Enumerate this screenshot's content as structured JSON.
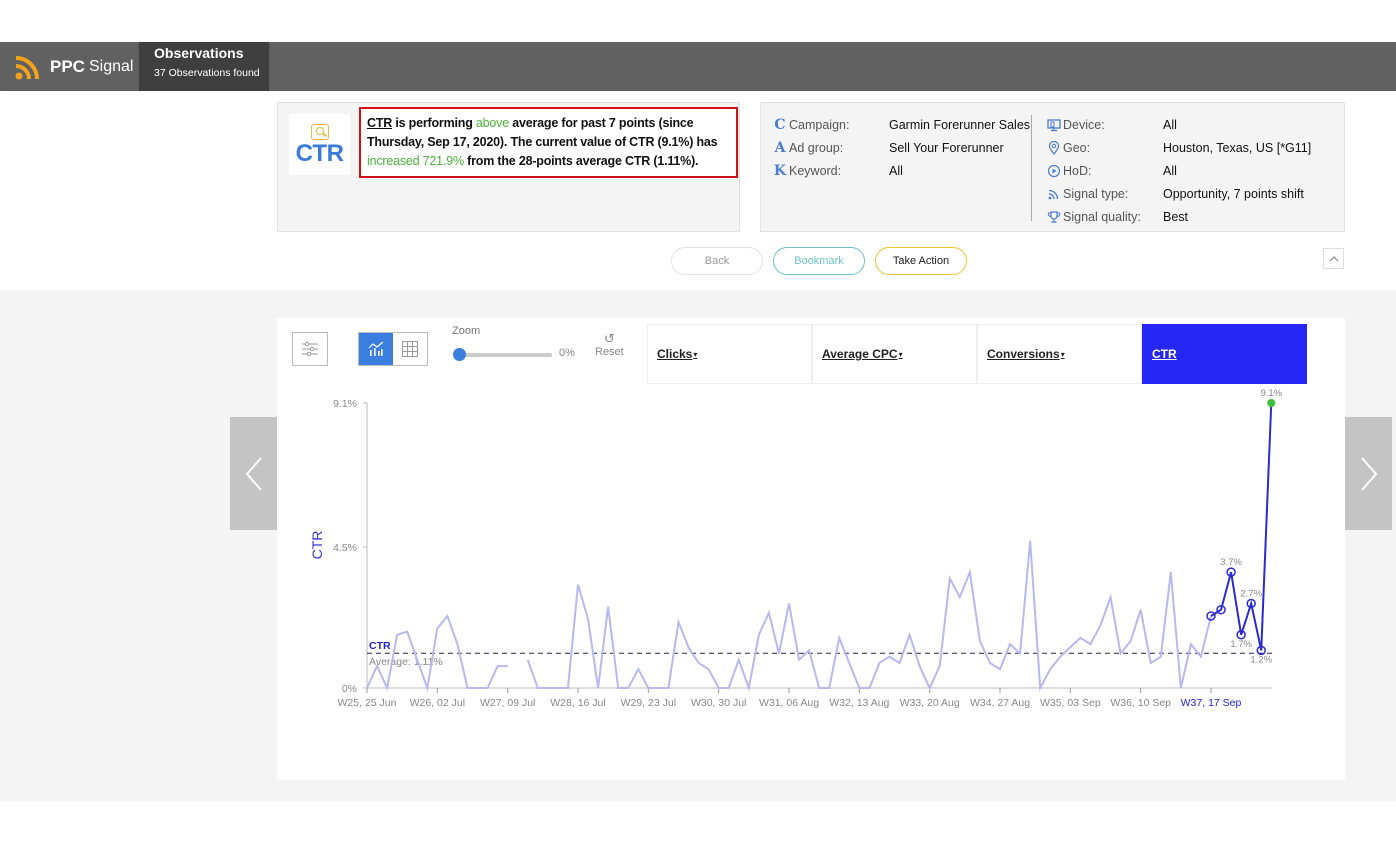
{
  "header": {
    "brand_bold": "PPC",
    "brand_light": "Signal",
    "tab_title": "Observations",
    "tab_subtitle": "37 Observations found"
  },
  "insight": {
    "icon_label": "CTR",
    "metric": "CTR",
    "part1": " is performing ",
    "direction": "above",
    "part2": " average for past 7 points (since Thursday, Sep 17, 2020). The current value of CTR (9.1%) has ",
    "change": "increased 721.9%",
    "part3": " from the 28-points average CTR (1.11%)."
  },
  "meta": {
    "left": [
      {
        "icon": "campaign-icon",
        "glyph": "C",
        "label": "Campaign:",
        "value": "Garmin Forerunner Sales"
      },
      {
        "icon": "ad-group-icon",
        "glyph": "A",
        "label": "Ad group:",
        "value": "Sell Your Forerunner"
      },
      {
        "icon": "keyword-icon",
        "glyph": "K",
        "label": "Keyword:",
        "value": "All"
      }
    ],
    "right": [
      {
        "icon": "device-icon",
        "label": "Device:",
        "value": "All"
      },
      {
        "icon": "geo-pin-icon",
        "label": "Geo:",
        "value": "Houston, Texas, US [*G11]"
      },
      {
        "icon": "hod-clock-icon",
        "label": "HoD:",
        "value": "All"
      },
      {
        "icon": "signal-type-icon",
        "label": "Signal type:",
        "value": "Opportunity, 7 points shift"
      },
      {
        "icon": "trophy-icon",
        "label": "Signal quality:",
        "value": "Best"
      }
    ]
  },
  "actions": {
    "back": "Back",
    "bookmark": "Bookmark",
    "take_action": "Take Action"
  },
  "toolbar": {
    "zoom_label": "Zoom",
    "zoom_value": "0%",
    "zoom_fraction": 0,
    "reset_label": "Reset"
  },
  "metric_tabs": [
    {
      "label": "Clicks",
      "arrow": "▾",
      "active": false
    },
    {
      "label": "Average CPC",
      "arrow": "▾",
      "active": false
    },
    {
      "label": "Conversions",
      "arrow": "▾",
      "active": false
    },
    {
      "label": "CTR",
      "arrow": "",
      "active": true
    }
  ],
  "colors": {
    "accent_blue": "#2626f5",
    "line_light": "#b8b8f0",
    "highlight_line": "#2a2ad4",
    "current_point": "#3cc03c",
    "green_text": "#4bb33a",
    "alert_red": "#d0121b"
  },
  "chart_data": {
    "type": "line",
    "title": "",
    "ylabel": "CTR",
    "xlabel": "",
    "ylim": [
      0,
      9.1
    ],
    "yticks": [
      "0%",
      "4.5%",
      "9.1%"
    ],
    "ytick_values": [
      0,
      4.5,
      9.1
    ],
    "xticks": [
      "W25, 25 Jun",
      "W26, 02 Jul",
      "W27, 09 Jul",
      "W28, 16 Jul",
      "W29, 23 Jul",
      "W30, 30 Jul",
      "W31, 06 Aug",
      "W32, 13 Aug",
      "W33, 20 Aug",
      "W34, 27 Aug",
      "W35, 03 Sep",
      "W36, 10 Sep",
      "W37, 17 Sep"
    ],
    "xtick_highlight": "W37, 17 Sep",
    "points_per_tick": 7,
    "values": [
      0,
      0.7,
      0,
      1.7,
      1.8,
      0.9,
      0,
      1.9,
      2.3,
      1.4,
      0,
      0,
      0,
      0.7,
      0.7,
      null,
      0.9,
      0,
      0,
      0,
      0,
      3.3,
      2.2,
      0,
      2.6,
      0,
      0,
      0.6,
      0,
      0,
      0,
      2.1,
      1.3,
      0.8,
      0.6,
      0,
      0,
      0.9,
      0,
      1.7,
      2.4,
      1.1,
      2.7,
      0.9,
      1.2,
      0,
      0,
      1.6,
      0.8,
      0,
      0,
      0.8,
      1.0,
      0.8,
      1.7,
      0.7,
      0,
      0.7,
      3.5,
      2.9,
      3.7,
      1.5,
      0.8,
      0.6,
      1.4,
      1.1,
      4.7,
      0,
      0.6,
      1.0,
      1.3,
      1.6,
      1.4,
      2.0,
      2.9,
      1.1,
      1.5,
      2.5,
      0.8,
      1.0,
      3.7,
      0,
      1.4,
      1.0,
      2.3,
      2.5,
      3.7,
      1.7,
      2.7,
      1.2,
      9.1
    ],
    "highlight_start_index": 84,
    "point_labels": [
      {
        "index": 86,
        "text": "3.7%"
      },
      {
        "index": 87,
        "text": "1.7%"
      },
      {
        "index": 88,
        "text": "2.7%"
      },
      {
        "index": 89,
        "text": "1.2%"
      },
      {
        "index": 90,
        "text": "9.1%"
      }
    ],
    "average": {
      "value": 1.11,
      "series_label": "CTR",
      "label": "Average: 1.11%"
    }
  }
}
